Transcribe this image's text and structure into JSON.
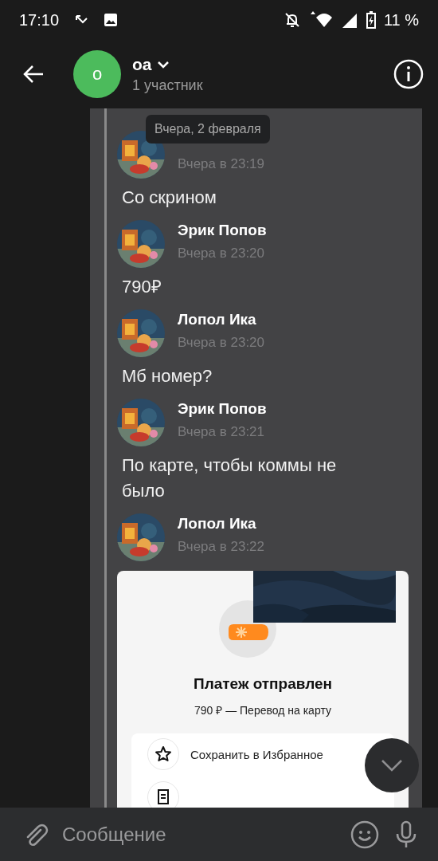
{
  "status_bar": {
    "time": "17:10",
    "battery": "11 %"
  },
  "header": {
    "avatar_letter": "о",
    "title": "оа",
    "subtitle": "1 участник"
  },
  "date_pill": "Вчера, 2 февраля",
  "messages": [
    {
      "time": "Вчера в 23:19",
      "text": "Со скрином"
    },
    {
      "author": "Эрик Попов",
      "time": "Вчера в 23:20",
      "text": "790₽"
    },
    {
      "author": "Лопол Ика",
      "time": "Вчера в 23:20",
      "text": "Мб номер?"
    },
    {
      "author": "Эрик Попов",
      "time": "Вчера в 23:21",
      "text": "По карте, чтобы коммы не было"
    },
    {
      "author": "Лопол Ика",
      "time": "Вчера в 23:22",
      "attachment": {
        "kind": "screenshot",
        "title": "Платеж отправлен",
        "subtitle": "790 ₽ — Перевод на карту",
        "actions": [
          "Сохранить в Избранное"
        ]
      }
    }
  ],
  "composer": {
    "placeholder": "Сообщение"
  }
}
